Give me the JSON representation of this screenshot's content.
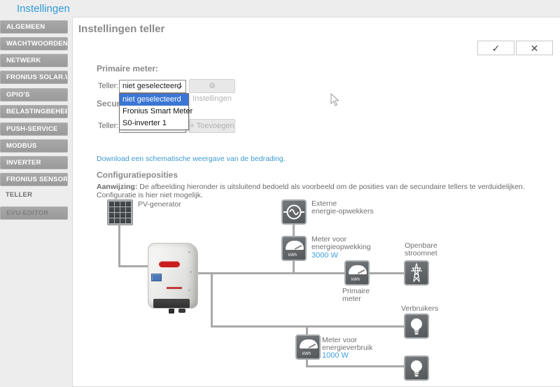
{
  "page_title": "Instellingen",
  "sidebar": {
    "items": [
      {
        "label": "ALGEMEEN"
      },
      {
        "label": "WACHTWOORDEN"
      },
      {
        "label": "NETWERK"
      },
      {
        "label": "FRONIUS SOLAR.WEB"
      },
      {
        "label": "GPIO'S"
      },
      {
        "label": "BELASTINGBEHEER"
      },
      {
        "label": "PUSH-SERVICE"
      },
      {
        "label": "MODBUS"
      },
      {
        "label": "INVERTER"
      },
      {
        "label": "FRONIUS SENSOR CARDS"
      }
    ],
    "active_item": "TELLER",
    "bottom_item": "EVU-EDITOR"
  },
  "content": {
    "title": "Instellingen teller",
    "toolbar": {
      "confirm_glyph": "✓",
      "cancel_glyph": "✕"
    },
    "primary_meter": {
      "heading": "Primaire meter:",
      "teller_label": "Teller:",
      "select_value": "niet geselecteerd",
      "settings_icon": "⚙",
      "settings_button": "Instellingen"
    },
    "dropdown": {
      "options": [
        "niet geselecteerd",
        "Fronius Smart Meter",
        "S0-inverter 1"
      ],
      "selected": "niet geselecteerd"
    },
    "secondary_meter": {
      "heading": "Secundaire meter:",
      "teller_label": "Teller:",
      "select_value": "niet geselecteerd",
      "add_icon": "+",
      "add_button": "Toevoegen"
    },
    "wiring_link": "Download een schematische weergave van de bedrading.",
    "config": {
      "heading": "Configuratieposities",
      "note_label": "Aanwijzing:",
      "note_text": " De afbeelding hieronder is uitsluitend bedoeld als voorbeeld om de posities van de secundaire tellers te verduidelijken. Configuratie is hier niet mogelijk."
    }
  },
  "diagram": {
    "pv_label": "PV-generator",
    "external_label": "Externe\nenergie-opwekkers",
    "meter_gen_label": "Meter voor\nenergieopwekking",
    "meter_gen_value": "3000 W",
    "grid_label": "Openbare\nstroomnet",
    "primary_meter_label": "Primaire\nmeter",
    "consumers_label": "Verbruikers",
    "meter_cons_label": "Meter voor\nenergieverbruik",
    "meter_cons_value": "1000 W",
    "kwh_label": "kWh"
  },
  "colors": {
    "accent_blue": "#2f9bd8",
    "value_blue": "#3f9fdb",
    "link_blue": "#3d9ad2",
    "highlight_blue": "#3b76d6",
    "icon_gray": "#63676b",
    "line_gray": "#a9a9a9"
  }
}
